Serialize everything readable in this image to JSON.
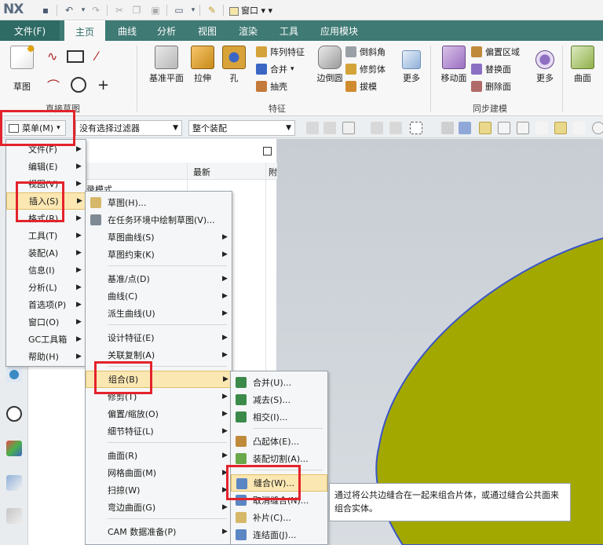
{
  "app": {
    "logo": "NX",
    "window_menu": "窗口"
  },
  "tabs": {
    "file": "文件(F)",
    "items": [
      "主页",
      "曲线",
      "分析",
      "视图",
      "渲染",
      "工具",
      "应用模块"
    ]
  },
  "ribbon": {
    "sketch": "草图",
    "direct_sketch_group": "直接草图",
    "datum_plane": "基准平面",
    "extrude": "拉伸",
    "hole": "孔",
    "pattern_feature": "阵列特征",
    "unite": "合并",
    "shell": "抽壳",
    "edge_blend": "边倒圆",
    "chamfer": "倒斜角",
    "trim_body": "修剪体",
    "draft": "拔模",
    "more1": "更多",
    "feature_group": "特征",
    "move_face": "移动面",
    "offset_region": "偏置区域",
    "replace_face": "替换面",
    "delete_face": "删除面",
    "more2": "更多",
    "sync_group": "同步建模",
    "surface": "曲面"
  },
  "filterbar": {
    "menu_button": "菜单(M)",
    "filter_combo": "没有选择过滤器",
    "assembly_combo": "整个装配"
  },
  "navigator": {
    "col_latest": "最新",
    "row_text": "录模式"
  },
  "main_menu": {
    "items": [
      "文件(F)",
      "编辑(E)",
      "视图(V)",
      "插入(S)",
      "格式(R)",
      "工具(T)",
      "装配(A)",
      "信息(I)",
      "分析(L)",
      "首选项(P)",
      "窗口(O)",
      "GC工具箱",
      "帮助(H)"
    ]
  },
  "insert_menu": {
    "items": [
      "草图(H)...",
      "在任务环境中绘制草图(V)...",
      "草图曲线(S)",
      "草图约束(K)",
      "基准/点(D)",
      "曲线(C)",
      "派生曲线(U)",
      "设计特征(E)",
      "关联复制(A)",
      "组合(B)",
      "修剪(T)",
      "偏置/缩放(O)",
      "细节特征(L)",
      "曲面(R)",
      "网格曲面(M)",
      "扫掠(W)",
      "弯边曲面(G)",
      "CAM 数据准备(P)"
    ]
  },
  "combine_menu": {
    "items": [
      "合并(U)...",
      "减去(S)...",
      "相交(I)...",
      "凸起体(E)...",
      "装配切割(A)...",
      "缝合(W)...",
      "取消缝合(N)...",
      "补片(C)...",
      "连结面(J)..."
    ]
  },
  "tooltip": {
    "text": "通过将公共边缝合在一起来组合片体，或通过缝合公共面来组合实体。"
  },
  "colors": {
    "accent": "#3f7a74",
    "highlight": "#fbe7b2",
    "annotation": "#e3232b",
    "surface": "#a3a800",
    "edge": "#3a55c8"
  }
}
